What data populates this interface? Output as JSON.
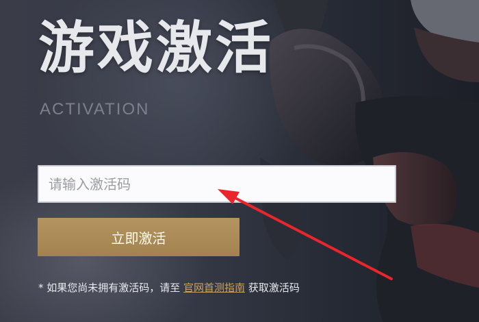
{
  "heading": {
    "title_cn": "游戏激活",
    "title_en": "ACTIVATION"
  },
  "form": {
    "code_placeholder": "请输入激活码",
    "activate_label": "立即激活"
  },
  "note": {
    "prefix": "* 如果您尚未拥有激活码，请至 ",
    "link_text": "官网首测指南",
    "suffix": " 获取激活码"
  },
  "colors": {
    "accent_gold": "#b49460",
    "link_gold": "#c9a461",
    "annotation_arrow": "#e8262b"
  },
  "icons": {
    "arrow": "annotation-arrow-icon"
  }
}
